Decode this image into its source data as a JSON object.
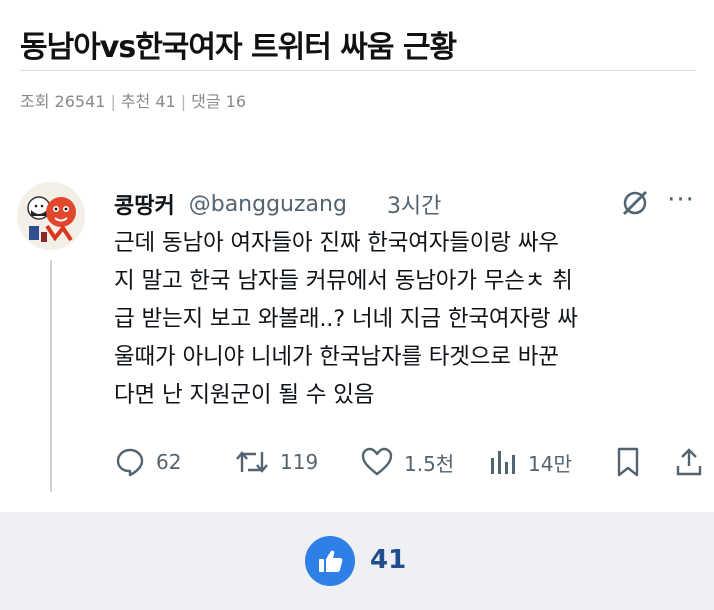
{
  "post": {
    "title": "동남아vs한국여자 트위터 싸움 근황",
    "views_label": "조회 26541",
    "recommends_label": "추천 41",
    "comments_label": "댓글 16"
  },
  "tweet": {
    "display_name": "콩땅커",
    "handle": "@bangguzang",
    "time": "3시간",
    "body_lines": [
      "근데 동남아 여자들아 진짜 한국여자들이랑 싸우",
      "지 말고 한국 남자들 커뮤에서 동남아가 무슨ㅊ 취",
      "급 받는지 보고 와볼래..? 너네 지금 한국여자랑 싸",
      "울때가 아니야 니네가 한국남자를 타겟으로 바꾼",
      "다면 난 지원군이 될 수 있음"
    ],
    "actions": {
      "replies": "62",
      "reposts": "119",
      "likes": "1.5천",
      "views": "14만"
    }
  },
  "vote": {
    "count": "41",
    "accent_color": "#2e7fe6"
  },
  "icons": [
    "avatar",
    "grok-icon",
    "more-icon",
    "reply-icon",
    "repost-icon",
    "like-icon",
    "views-icon",
    "bookmark-icon",
    "share-icon",
    "thumbs-up-icon"
  ]
}
